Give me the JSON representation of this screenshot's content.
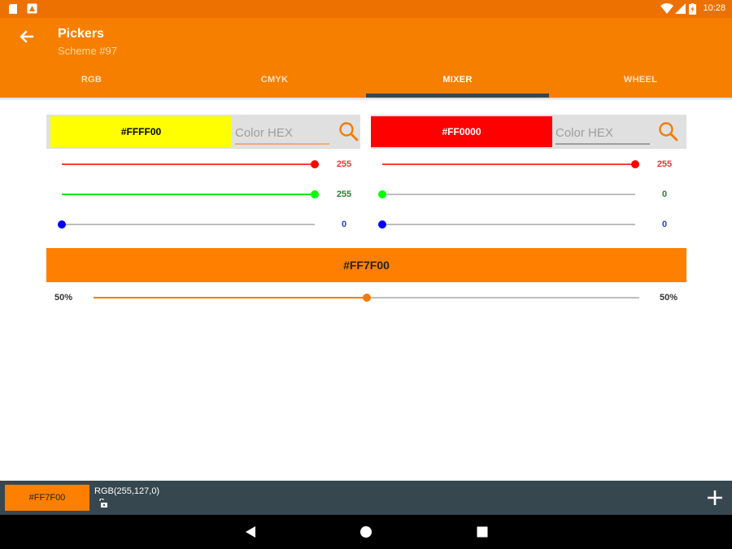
{
  "status": {
    "time": "10:28"
  },
  "appbar": {
    "title": "Pickers",
    "subtitle": "Scheme #97"
  },
  "tabs": [
    {
      "label": "RGB",
      "active": false
    },
    {
      "label": "CMYK",
      "active": false
    },
    {
      "label": "MIXER",
      "active": true
    },
    {
      "label": "WHEEL",
      "active": false
    }
  ],
  "colors": {
    "brand": "#F77F00",
    "status_bar": "#ED7100",
    "tab_indicator": "#37474F",
    "bottom_bar": "#37474F",
    "accent": "#F57C00"
  },
  "mixer": {
    "color1": {
      "hex": "#FFFF00",
      "swatch_color": "#FFFF00",
      "placeholder": "Color HEX",
      "r": 255,
      "g": 255,
      "b": 0,
      "r_label": "255",
      "g_label": "255",
      "b_label": "0"
    },
    "color2": {
      "hex": "#FF0000",
      "swatch_color": "#FF0000",
      "placeholder": "Color HEX",
      "r": 255,
      "g": 0,
      "b": 0,
      "r_label": "255",
      "g_label": "0",
      "b_label": "0"
    },
    "result": {
      "hex": "#FF7F00",
      "color": "#FF7F00"
    },
    "ratio": {
      "value": 0.5,
      "left_label": "50%",
      "right_label": "50%"
    }
  },
  "bottom": {
    "hex": "#FF7F00",
    "rgb_text": "RGB(255,127,0)",
    "add_icon": "plus-icon",
    "lock_icon": "lock-icon"
  },
  "nav": {
    "back_icon": "triangle-back-icon",
    "home_icon": "circle-home-icon",
    "recents_icon": "square-recents-icon"
  }
}
